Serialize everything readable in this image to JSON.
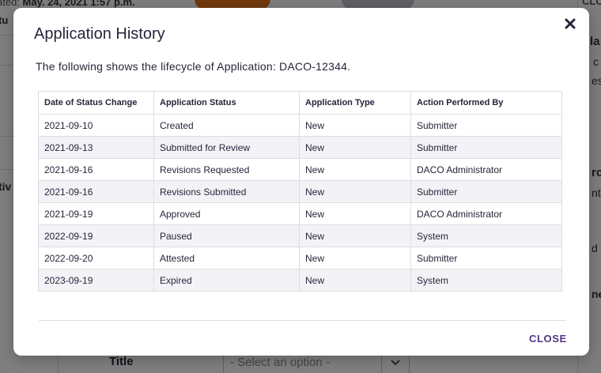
{
  "background": {
    "created_label": "ated:",
    "created_value": "May. 24, 2021 1:57 p.m.",
    "status_fragment": "tu",
    "close_fragment": "CLO",
    "left_fragment": "tiv",
    "right_fragments": [
      "la",
      "c",
      "es",
      "rc",
      "nt",
      "d",
      "ne"
    ],
    "title_label": "Title",
    "select_placeholder": "- Select an option -"
  },
  "modal": {
    "title": "Application History",
    "intro": "The following shows the lifecycle of Application: DACO-12344.",
    "close_label": "CLOSE",
    "table": {
      "headers": [
        "Date of Status Change",
        "Application Status",
        "Application Type",
        "Action Performed By"
      ],
      "rows": [
        [
          "2021-09-10",
          "Created",
          "New",
          "Submitter"
        ],
        [
          "2021-09-13",
          "Submitted for Review",
          "New",
          "Submitter"
        ],
        [
          "2021-09-16",
          "Revisions Requested",
          "New",
          "DACO Administrator"
        ],
        [
          "2021-09-16",
          "Revisions Submitted",
          "New",
          "Submitter"
        ],
        [
          "2021-09-19",
          "Approved",
          "New",
          "DACO Administrator"
        ],
        [
          "2022-09-19",
          "Paused",
          "New",
          "System"
        ],
        [
          "2022-09-20",
          "Attested",
          "New",
          "Submitter"
        ],
        [
          "2023-09-19",
          "Expired",
          "New",
          "System"
        ]
      ]
    }
  },
  "colors": {
    "accent": "#523785",
    "text": "#28243a",
    "border": "#dcdde1",
    "row_alt": "#f3f3f7"
  },
  "icons": {
    "close": "close-x-icon",
    "chevron": "chevron-down-icon"
  }
}
